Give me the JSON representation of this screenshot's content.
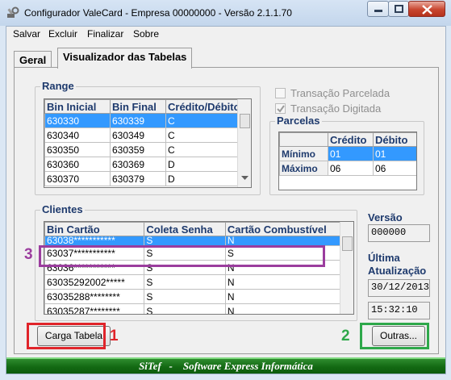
{
  "window": {
    "title": "Configurador ValeCard - Empresa 00000000 - Versão 2.1.1.70",
    "app_icon": "tools-icon"
  },
  "menu": [
    "Salvar",
    "Excluir",
    "Finalizar",
    "Sobre"
  ],
  "tabs": [
    {
      "label": "Geral",
      "active": false
    },
    {
      "label": "Visualizador das Tabelas",
      "active": true
    }
  ],
  "range": {
    "title": "Range",
    "columns": [
      "Bin Inicial",
      "Bin Final",
      "Crédito/Débito"
    ],
    "rows": [
      [
        "630330",
        "630339",
        "C"
      ],
      [
        "630340",
        "630349",
        "C"
      ],
      [
        "630350",
        "630359",
        "C"
      ],
      [
        "630360",
        "630369",
        "D"
      ],
      [
        "630370",
        "630379",
        "D"
      ]
    ],
    "selected_row": 0
  },
  "options": {
    "parcelada": {
      "label": "Transação Parcelada",
      "checked": false
    },
    "digitada": {
      "label": "Transação Digitada",
      "checked": true
    }
  },
  "parcelas": {
    "title": "Parcelas",
    "columns": [
      "",
      "Crédito",
      "Débito"
    ],
    "rows": [
      [
        "Mínimo",
        "01",
        "01"
      ],
      [
        "Máximo",
        "06",
        "06"
      ]
    ],
    "selected_row": 0
  },
  "clientes": {
    "title": "Clientes",
    "columns": [
      "Bin Cartão",
      "Coleta Senha",
      "Cartão Combustível"
    ],
    "rows": [
      [
        "63038***********",
        "S",
        "N"
      ],
      [
        "63037***********",
        "S",
        "S"
      ],
      [
        "63036***********",
        "S",
        "N"
      ],
      [
        "63035292002*****",
        "S",
        "N"
      ],
      [
        "63035288********",
        "S",
        "N"
      ],
      [
        "63035287********",
        "S",
        "N"
      ]
    ],
    "selected_row": 0
  },
  "versao": {
    "label": "Versão",
    "value": "000000"
  },
  "ultima": {
    "label_line1": "Última",
    "label_line2": "Atualização",
    "date": "30/12/2013",
    "time": "15:32:10"
  },
  "buttons": {
    "carga": "Carga Tabela",
    "outras": "Outras..."
  },
  "status": "SiTef   -    Software Express Informática",
  "annotations": [
    {
      "number": "1",
      "color": "#e0242a"
    },
    {
      "number": "2",
      "color": "#2ea84a"
    },
    {
      "number": "3",
      "color": "#9b3d9e"
    }
  ]
}
